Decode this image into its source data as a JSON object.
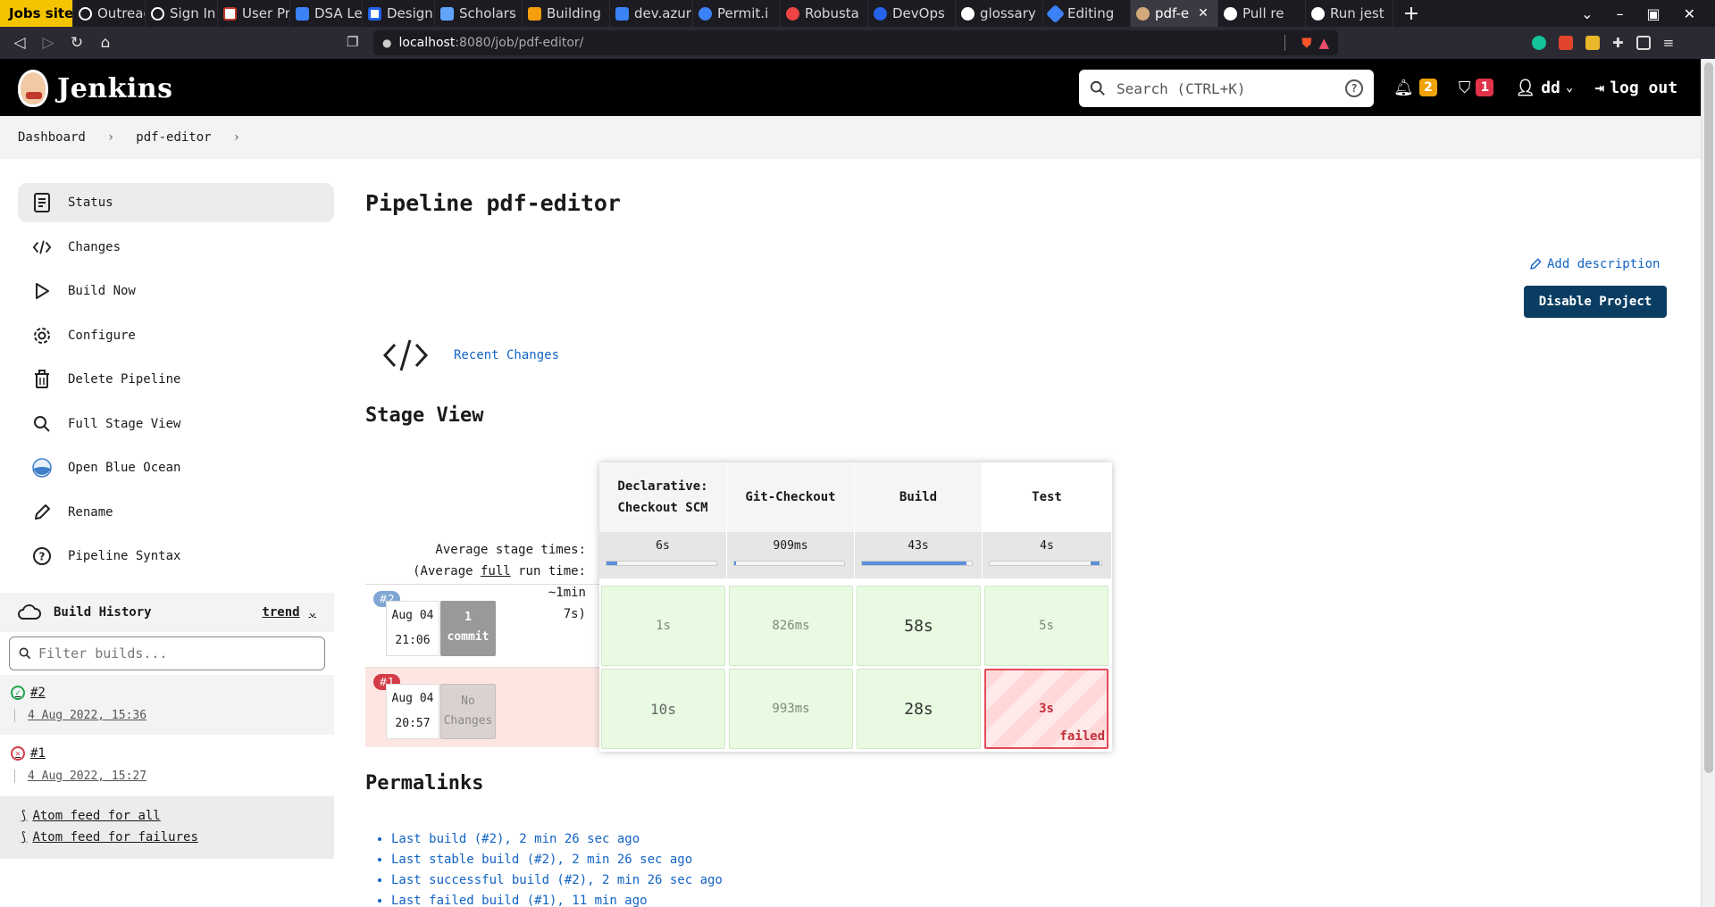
{
  "browser": {
    "tabs": [
      {
        "title": "Jobs sites",
        "color": "#f5c400"
      },
      {
        "title": "Outreach",
        "color": "#ffffff"
      },
      {
        "title": "Sign In",
        "color": "#ffffff"
      },
      {
        "title": "User Pro",
        "color": "#ffffff"
      },
      {
        "title": "DSA Leet",
        "color": "#3b82f6"
      },
      {
        "title": "Designin",
        "color": "#2563eb"
      },
      {
        "title": "Scholars",
        "color": "#60a5fa"
      },
      {
        "title": "Building",
        "color": "#f59e0b"
      },
      {
        "title": "dev.azur",
        "color": "#3b82f6"
      },
      {
        "title": "Permit.i",
        "color": "#3b82f6"
      },
      {
        "title": "Robusta",
        "color": "#ef4444"
      },
      {
        "title": "DevOps",
        "color": "#2563eb"
      },
      {
        "title": "glossary",
        "color": "#ffffff"
      },
      {
        "title": "Editing",
        "color": "#3b82f6"
      },
      {
        "title": "pdf-e",
        "color": "#d1a97a"
      },
      {
        "title": "Pull re",
        "color": "#ffffff"
      },
      {
        "title": "Run jest",
        "color": "#ffffff"
      }
    ],
    "url_host": "localhost",
    "url_rest": ":8080/job/pdf-editor/"
  },
  "header": {
    "logo_text": "Jenkins",
    "search_placeholder": "Search (CTRL+K)",
    "search_help": "?",
    "notifications_count": "2",
    "security_count": "1",
    "user": "dd",
    "logout": "log out"
  },
  "breadcrumb": {
    "items": [
      "Dashboard",
      "pdf-editor"
    ]
  },
  "sidebar": {
    "items": [
      {
        "label": "Status",
        "icon": "status-icon"
      },
      {
        "label": "Changes",
        "icon": "code-icon"
      },
      {
        "label": "Build Now",
        "icon": "play-icon"
      },
      {
        "label": "Configure",
        "icon": "gear-icon"
      },
      {
        "label": "Delete Pipeline",
        "icon": "trash-icon"
      },
      {
        "label": "Full Stage View",
        "icon": "search-icon"
      },
      {
        "label": "Open Blue Ocean",
        "icon": "blue-ocean-icon"
      },
      {
        "label": "Rename",
        "icon": "pencil-icon"
      },
      {
        "label": "Pipeline Syntax",
        "icon": "help-icon"
      }
    ]
  },
  "build_history": {
    "title": "Build History",
    "trend": "trend",
    "filter_placeholder": "Filter builds...",
    "builds": [
      {
        "id": "#2",
        "date": "4 Aug 2022, 15:36",
        "status": "success"
      },
      {
        "id": "#1",
        "date": "4 Aug 2022, 15:27",
        "status": "failed"
      }
    ],
    "feed_all": "Atom feed for all",
    "feed_failures": "Atom feed for failures"
  },
  "main": {
    "title": "Pipeline pdf-editor",
    "add_description": "Add description",
    "disable_button": "Disable Project",
    "recent_changes": "Recent Changes",
    "stage_view_title": "Stage View",
    "avg_line1": "Average stage times:",
    "avg_line2_pre": "(Average ",
    "avg_line2_link": "full",
    "avg_line2_post": " run time: ~1min",
    "avg_line3": "7s)",
    "permalinks_title": "Permalinks",
    "permalinks": [
      "Last build (#2), 2 min 26 sec ago",
      "Last stable build (#2), 2 min 26 sec ago",
      "Last successful build (#2), 2 min 26 sec ago",
      "Last failed build (#1), 11 min ago"
    ]
  },
  "stage_view": {
    "stages": [
      {
        "line1": "Declarative:",
        "line2": "Checkout SCM",
        "avg": "6s",
        "bar_start": 0.0,
        "bar_fraction": 0.1
      },
      {
        "line1": "Git-Checkout",
        "line2": "",
        "avg": "909ms",
        "bar_start": 0.0,
        "bar_fraction": 0.02
      },
      {
        "line1": "Build",
        "line2": "",
        "avg": "43s",
        "bar_start": 0.0,
        "bar_fraction": 0.95
      },
      {
        "line1": "Test",
        "line2": "",
        "avg": "4s",
        "bar_start": 0.9,
        "bar_fraction": 0.08
      }
    ],
    "runs": [
      {
        "badge": "#2",
        "badge_color": "#7fa6d4",
        "date": "Aug 04",
        "time": "21:06",
        "changes": "1 commit",
        "has_changes": true,
        "cells": [
          "1s",
          "826ms",
          "58s",
          "5s"
        ],
        "failed_index": -1
      },
      {
        "badge": "#1",
        "badge_color": "#d43c48",
        "date": "Aug 04",
        "time": "20:57",
        "changes": "No Changes",
        "has_changes": false,
        "cells": [
          "10s",
          "993ms",
          "28s",
          "3s"
        ],
        "failed_index": 3,
        "failed_label": "failed"
      }
    ]
  }
}
